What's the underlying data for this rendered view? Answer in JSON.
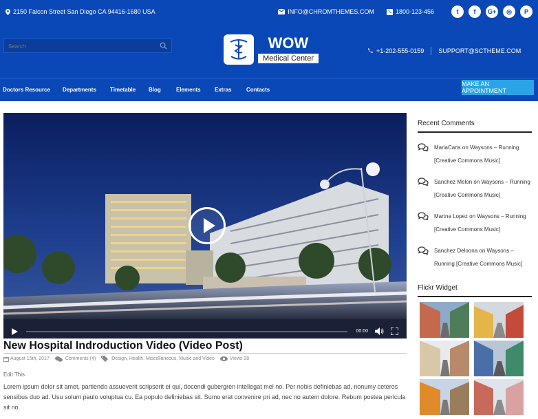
{
  "topbar": {
    "address": "2150 Falcon Street San Diego CA 94416-1680 USA",
    "email": "INFO@CHROMTHEMES.COM",
    "phone": "1800-123-456"
  },
  "social": [
    {
      "name": "twitter-icon",
      "glyph": "t"
    },
    {
      "name": "facebook-icon",
      "glyph": "f"
    },
    {
      "name": "google-plus-icon",
      "glyph": "G+"
    },
    {
      "name": "instagram-icon",
      "glyph": "◎"
    },
    {
      "name": "pinterest-icon",
      "glyph": "P"
    }
  ],
  "search": {
    "placeholder": "Search"
  },
  "logo": {
    "title": "WOW",
    "subtitle": "Medical Center"
  },
  "header_contact": {
    "phone": "+1-202-555-0159",
    "email": "SUPPORT@SCTHEME.COM"
  },
  "nav": {
    "items": [
      "Doctors Resource",
      "Departments",
      "Timetable",
      "Blog",
      "Elements",
      "Extras",
      "Contacts"
    ],
    "appointment": "MAKE AN APPOINTMENT"
  },
  "video": {
    "time": "00:00"
  },
  "post": {
    "title": "New Hospital Indroduction Video (Video Post)",
    "date": "August 15th, 2017",
    "comments": "Comments (4)",
    "categories": "Design, Health, Miscellaneous, Music and Video",
    "views": "Views 28",
    "edit": "Edit This",
    "excerpt": "Lorem ipsum dolor sit amet, partiendo assueverit scripserit ei qui, docendi gubergren intellegat mel no. Per nobis definiebas ad, nonumy ceteros sensibus duo ad. Usu solum paulo voluptua cu. Ea populo definiebas sit. Sumo erat convenire pri ad, nec no autem dolore. Rebum postea pericula sit no."
  },
  "sidebar": {
    "recent_title": "Recent Comments",
    "comments": [
      {
        "author": "MariaCans",
        "on": "on",
        "link": "Waysons – Running [Creative Commons Music]"
      },
      {
        "author": "Sanchez Melon",
        "on": "on",
        "link": "Waysons – Running [Creative Commons Music]"
      },
      {
        "author": "Martna Lopez",
        "on": "on",
        "link": "Waysons – Running [Creative Commons Music]"
      },
      {
        "author": "Sanchez Deloona",
        "on": "on",
        "link": "Waysons – Running [Creative Commons Music]"
      }
    ],
    "flickr_title": "Flickr Widget"
  },
  "colors": {
    "brand": "#0a48b8",
    "accent": "#2aa4e6"
  }
}
